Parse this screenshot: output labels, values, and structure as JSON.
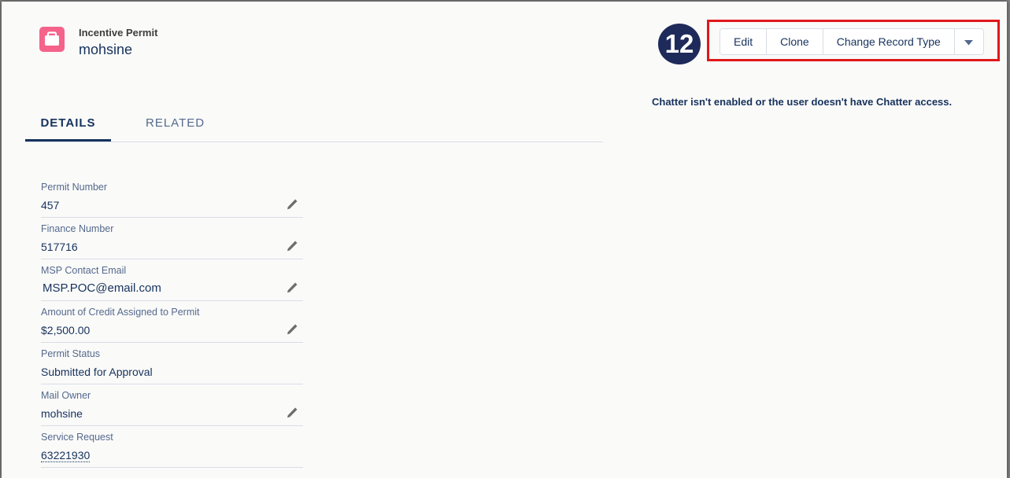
{
  "header": {
    "object_type": "Incentive Permit",
    "record_name": "mohsine",
    "icon": "briefcase-icon"
  },
  "annotation": {
    "step_number": "12"
  },
  "actions": {
    "edit": "Edit",
    "clone": "Clone",
    "change_record_type": "Change Record Type",
    "more_icon": "chevron-down-icon"
  },
  "chatter": {
    "message": "Chatter isn't enabled or the user doesn't have Chatter access."
  },
  "tabs": {
    "details": "DETAILS",
    "related": "RELATED"
  },
  "fields": [
    {
      "label": "Permit Number",
      "value": "457"
    },
    {
      "label": "Finance Number",
      "value": "517716"
    },
    {
      "label": "MSP Contact Email",
      "value": "MSP.POC@email.com"
    },
    {
      "label": "Amount of Credit Assigned to Permit",
      "value": "$2,500.00"
    },
    {
      "label": "Permit Status",
      "value": "Submitted for Approval"
    },
    {
      "label": "Mail Owner",
      "value": "mohsine"
    },
    {
      "label": "Service Request",
      "value": "63221930"
    }
  ],
  "colors": {
    "accent": "#f5628a",
    "highlight": "#e0181a",
    "text": "#16325c",
    "badge": "#1e2a5a"
  }
}
